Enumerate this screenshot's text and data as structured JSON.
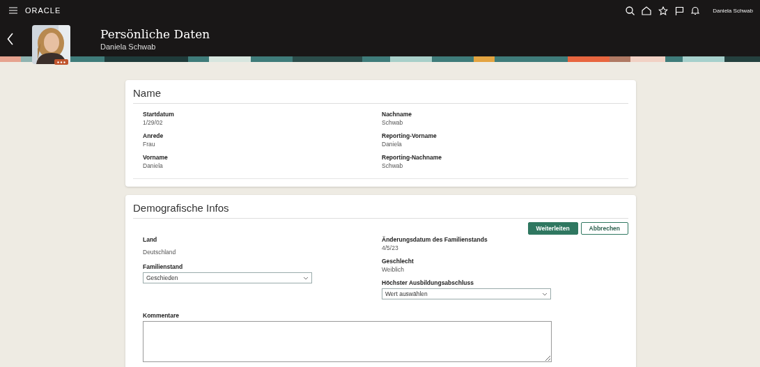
{
  "topbar": {
    "brand": "ORACLE",
    "user": "Daniela Schwab"
  },
  "header": {
    "title": "Persönliche Daten",
    "subtitle": "Daniela Schwab"
  },
  "name_section": {
    "title": "Name",
    "columns": [
      [
        {
          "label": "Startdatum",
          "value": "1/29/02"
        },
        {
          "label": "Anrede",
          "value": "Frau"
        },
        {
          "label": "Vorname",
          "value": "Daniela"
        }
      ],
      [
        {
          "label": "Nachname",
          "value": "Schwab"
        },
        {
          "label": "Reporting-Vorname",
          "value": "Daniela"
        },
        {
          "label": "Reporting-Nachname",
          "value": "Schwab"
        }
      ]
    ]
  },
  "demographics": {
    "title": "Demografische Infos",
    "buttons": [
      {
        "label": "Weiterleiten",
        "kind": "primary"
      },
      {
        "label": "Abbrechen",
        "kind": "secondary"
      }
    ],
    "columns": [
      [
        {
          "kind": "text",
          "label": "Land",
          "value": "Deutschland"
        },
        {
          "kind": "select",
          "label": "Familienstand",
          "value": "Geschieden"
        }
      ],
      [
        {
          "kind": "text",
          "label": "Änderungsdatum des Familienstands",
          "value": "4/5/23"
        },
        {
          "kind": "text",
          "label": "Geschlecht",
          "value": "Weiblich"
        },
        {
          "kind": "select",
          "label": "Höchster Ausbildungsabschluss",
          "value": "Wert auswählen"
        }
      ]
    ],
    "comments": {
      "label": "Kommentare"
    }
  }
}
